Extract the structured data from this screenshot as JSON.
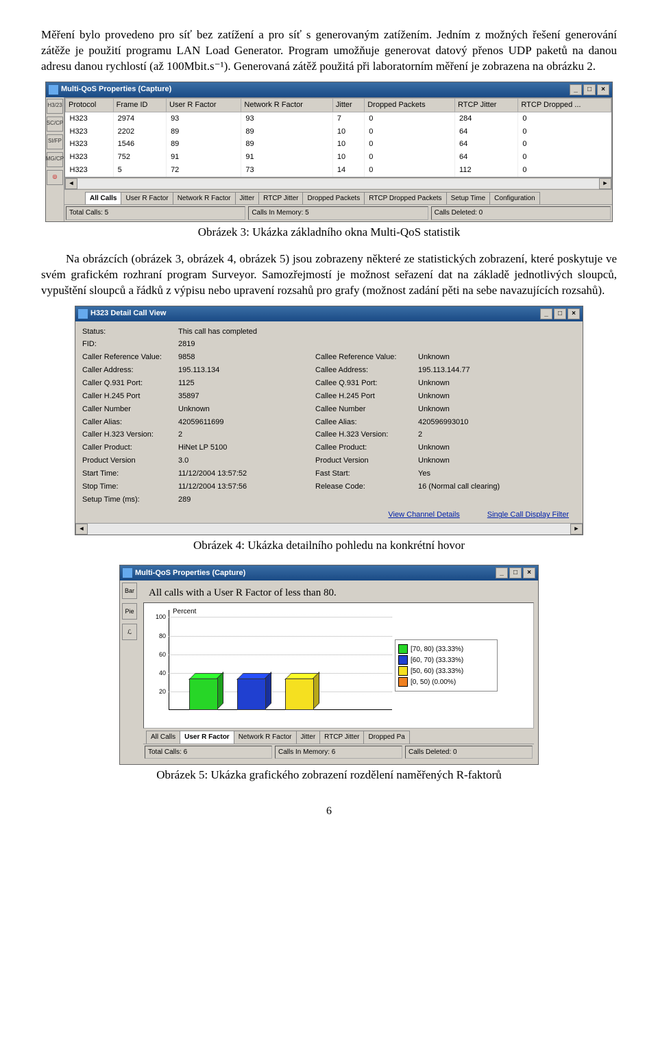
{
  "para1": "Měření bylo provedeno pro síť bez zatížení a pro síť s generovaným zatížením. Jedním z možných řešení generování zátěže je použití programu LAN Load Generator. Program umožňuje generovat datový přenos UDP paketů na danou adresu danou rychlostí (až 100Mbit.s⁻¹). Generovaná zátěž použitá při laboratorním měření je zobrazena na obrázku 2.",
  "caption3": "Obrázek 3: Ukázka základního okna Multi-QoS statistik",
  "para2": "Na obrázcích (obrázek 3, obrázek 4, obrázek 5) jsou zobrazeny některé ze statistických zobrazení, které poskytuje ve svém grafickém rozhraní program Surveyor. Samozřejmostí je možnost seřazení dat na základě jednotlivých sloupců, vypuštění sloupců a řádků z výpisu nebo upravení rozsahů pro grafy (možnost zadání pěti na sebe navazujících rozsahů).",
  "caption4": "Obrázek 4: Ukázka detailního pohledu na konkrétní hovor",
  "caption5": "Obrázek 5: Ukázka grafického zobrazení rozdělení naměřených R-faktorů",
  "pagenum": "6",
  "win1": {
    "title": "Multi-QoS Properties (Capture)",
    "side": [
      "H3/23",
      "SC/CP",
      "SI/FP",
      "MG/CP",
      "◎"
    ],
    "headers": [
      "Protocol",
      "Frame ID",
      "User R Factor",
      "Network R Factor",
      "Jitter",
      "Dropped Packets",
      "RTCP Jitter",
      "RTCP Dropped ..."
    ],
    "rows": [
      [
        "H323",
        "2974",
        "93",
        "93",
        "7",
        "0",
        "284",
        "0"
      ],
      [
        "H323",
        "2202",
        "89",
        "89",
        "10",
        "0",
        "64",
        "0"
      ],
      [
        "H323",
        "1546",
        "89",
        "89",
        "10",
        "0",
        "64",
        "0"
      ],
      [
        "H323",
        "752",
        "91",
        "91",
        "10",
        "0",
        "64",
        "0"
      ],
      [
        "H323",
        "5",
        "72",
        "73",
        "14",
        "0",
        "112",
        "0"
      ]
    ],
    "tabs": [
      "All Calls",
      "User R Factor",
      "Network R Factor",
      "Jitter",
      "RTCP Jitter",
      "Dropped Packets",
      "RTCP Dropped Packets",
      "Setup Time",
      "Configuration"
    ],
    "status": [
      "Total Calls: 5",
      "Calls In Memory: 5",
      "Calls Deleted: 0"
    ]
  },
  "win2": {
    "title": "H323 Detail Call View",
    "rows": [
      [
        "Status:",
        "This call has completed",
        "",
        ""
      ],
      [
        "FID:",
        "2819",
        "",
        ""
      ],
      [
        "Caller Reference Value:",
        "9858",
        "Callee Reference Value:",
        "Unknown"
      ],
      [
        "Caller Address:",
        "195.113.134",
        "Callee Address:",
        "195.113.144.77"
      ],
      [
        "Caller Q.931 Port:",
        "1125",
        "Callee Q.931 Port:",
        "Unknown"
      ],
      [
        "Caller H.245 Port",
        "35897",
        "Callee H.245 Port",
        "Unknown"
      ],
      [
        "Caller Number",
        "Unknown",
        "Callee Number",
        "Unknown"
      ],
      [
        "Caller Alias:",
        "42059611699",
        "Callee Alias:",
        "420596993010"
      ],
      [
        "Caller H.323 Version:",
        "2",
        "Callee H.323 Version:",
        "2"
      ],
      [
        "Caller Product:",
        "HiNet LP 5100",
        "Callee Product:",
        "Unknown"
      ],
      [
        "Product Version",
        "3.0",
        "Product Version",
        "Unknown"
      ],
      [
        "Start Time:",
        "11/12/2004  13:57:52",
        "Fast Start:",
        "Yes"
      ],
      [
        "Stop Time:",
        "11/12/2004  13:57:56",
        "Release Code:",
        "16 (Normal call clearing)"
      ],
      [
        "Setup Time (ms):",
        "289",
        "",
        ""
      ]
    ],
    "link1": "View Channel Details",
    "link2": "Single Call Display Filter"
  },
  "win3": {
    "title": "Multi-QoS Properties (Capture)",
    "side": [
      "Bar",
      "Pie",
      "ℒ"
    ],
    "heading": "All calls with a User R Factor of less than 80.",
    "ylabel": "Percent",
    "yticks": [
      "100",
      "80",
      "60",
      "40",
      "20"
    ],
    "legend": [
      {
        "color": "#27d627",
        "label": "[70, 80) (33.33%)"
      },
      {
        "color": "#2040d0",
        "label": "[60, 70) (33.33%)"
      },
      {
        "color": "#f5e020",
        "label": "[50, 60) (33.33%)"
      },
      {
        "color": "#f08020",
        "label": "[0, 50) (0.00%)"
      }
    ],
    "tabs": [
      "All Calls",
      "User R Factor",
      "Network R Factor",
      "Jitter",
      "RTCP Jitter",
      "Dropped Pa"
    ],
    "status": [
      "Total Calls: 6",
      "Calls In Memory: 6",
      "Calls Deleted: 0"
    ]
  },
  "chart_data": {
    "type": "bar",
    "title": "All calls with a User R Factor of less than 80.",
    "ylabel": "Percent",
    "ylim": [
      0,
      100
    ],
    "categories": [
      "[70, 80)",
      "[60, 70)",
      "[50, 60)",
      "[0, 50)"
    ],
    "values": [
      33.33,
      33.33,
      33.33,
      0.0
    ],
    "colors": [
      "#27d627",
      "#2040d0",
      "#f5e020",
      "#f08020"
    ]
  }
}
